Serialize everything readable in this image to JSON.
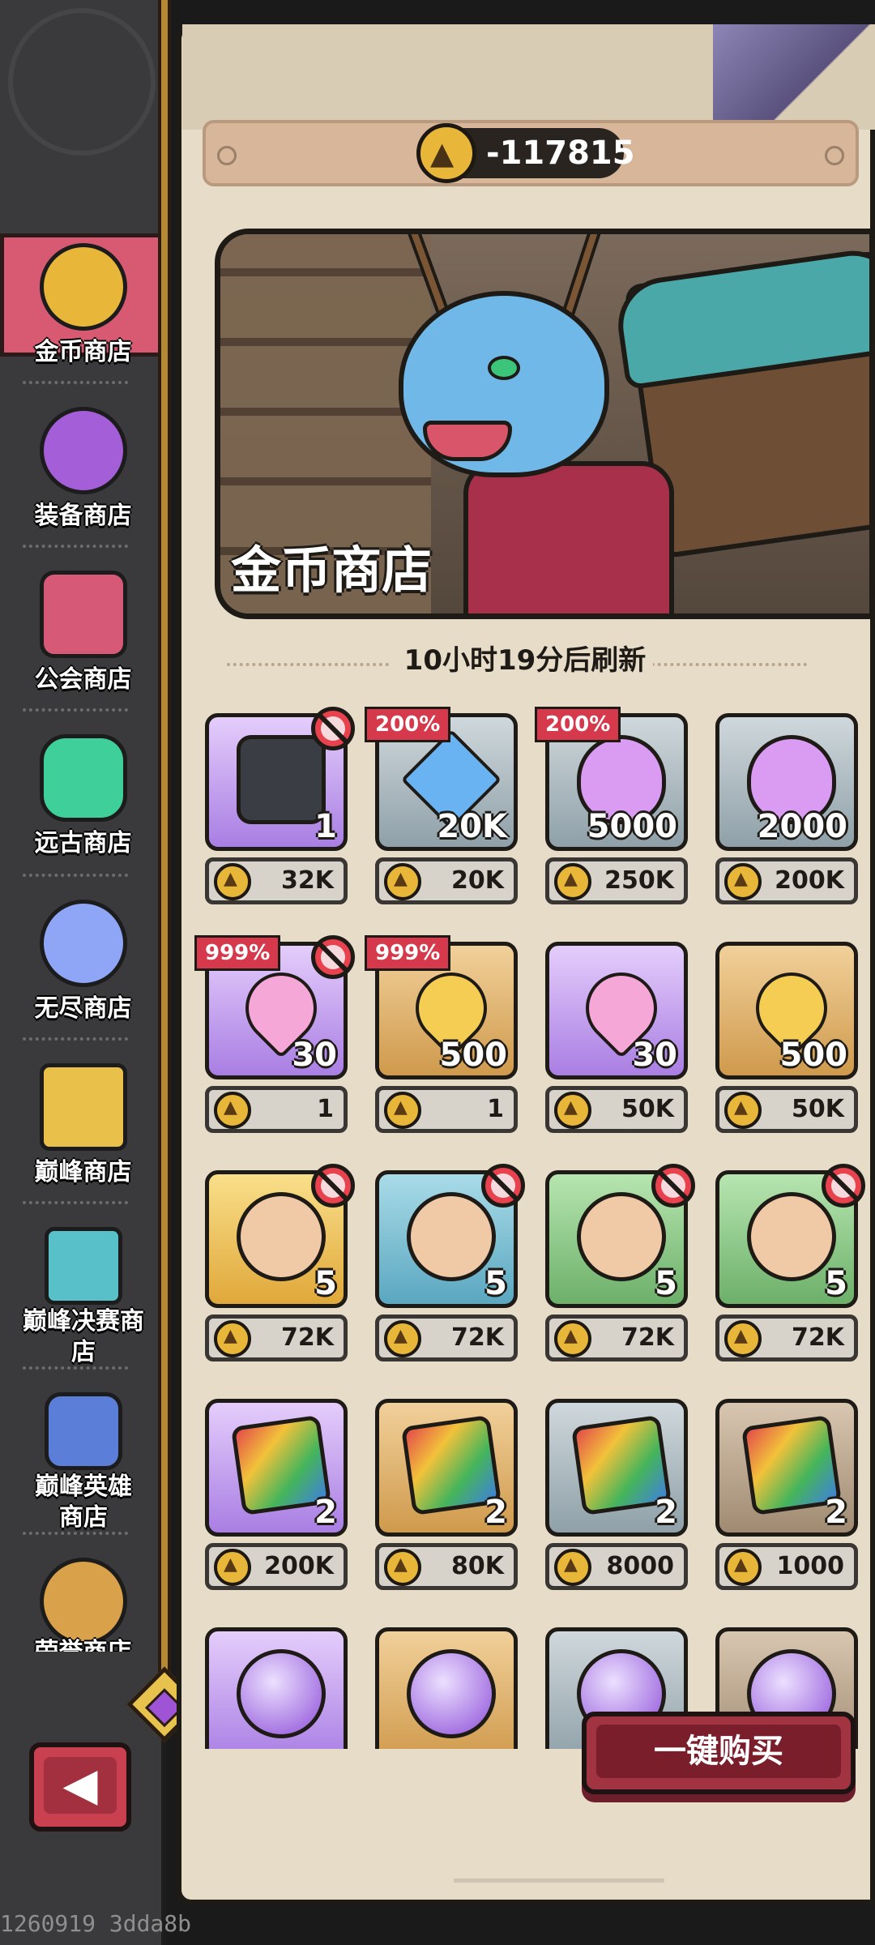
{
  "currency": {
    "icon": "coin-icon",
    "value": "-117815"
  },
  "banner": {
    "title": "金币商店"
  },
  "refresh": {
    "text": "10小时19分后刷新"
  },
  "sidebar": {
    "items": [
      {
        "label": "金币商店",
        "icon": "coin-icon",
        "active": true
      },
      {
        "label": "装备商店",
        "icon": "purple-gem-icon"
      },
      {
        "label": "公会商店",
        "icon": "guild-star-icon"
      },
      {
        "label": "远古商店",
        "icon": "green-crystal-icon"
      },
      {
        "label": "无尽商店",
        "icon": "blue-slime-icon"
      },
      {
        "label": "巅峰商店",
        "icon": "crown-icon"
      },
      {
        "label": "巅峰决赛商店",
        "icon": "teal-crown-icon"
      },
      {
        "label": "巅峰英雄商店",
        "icon": "hero-portrait-icon"
      },
      {
        "label": "荣誉商店",
        "icon": "crossed-swords-icon"
      }
    ]
  },
  "grid": {
    "items": [
      {
        "art": "helmet-book-icon",
        "bg": "purple",
        "qty": "1",
        "price": "32K",
        "promo": "",
        "locked": true
      },
      {
        "art": "blue-crystal-icon",
        "bg": "gray",
        "qty": "20K",
        "price": "20K",
        "promo": "200%",
        "locked": false
      },
      {
        "art": "purple-potion-icon",
        "bg": "gray",
        "qty": "5000",
        "price": "250K",
        "promo": "200%",
        "locked": false
      },
      {
        "art": "purple-potion-icon",
        "bg": "gray",
        "qty": "2000",
        "price": "200K",
        "promo": "",
        "locked": false
      },
      {
        "art": "pink-heart-icon",
        "bg": "purple",
        "qty": "30",
        "price": "1",
        "promo": "999%",
        "locked": true
      },
      {
        "art": "gold-heart-icon",
        "bg": "orange",
        "qty": "500",
        "price": "1",
        "promo": "999%",
        "locked": false
      },
      {
        "art": "pink-heart-icon",
        "bg": "purple",
        "qty": "30",
        "price": "50K",
        "promo": "",
        "locked": false
      },
      {
        "art": "gold-heart-icon",
        "bg": "orange",
        "qty": "500",
        "price": "50K",
        "promo": "",
        "locked": false
      },
      {
        "art": "hero-shard-girl-icon",
        "bg": "gold",
        "qty": "5",
        "price": "72K",
        "promo": "",
        "locked": true
      },
      {
        "art": "hero-shard-mask-icon",
        "bg": "teal",
        "qty": "5",
        "price": "72K",
        "promo": "",
        "locked": true
      },
      {
        "art": "hero-shard-elf-icon",
        "bg": "green",
        "qty": "5",
        "price": "72K",
        "promo": "",
        "locked": true
      },
      {
        "art": "hero-shard-sage-icon",
        "bg": "green",
        "qty": "5",
        "price": "72K",
        "promo": "",
        "locked": true
      },
      {
        "art": "summon-book-icon",
        "bg": "purple",
        "qty": "2",
        "price": "200K",
        "promo": "",
        "locked": false
      },
      {
        "art": "summon-book-icon",
        "bg": "orange",
        "qty": "2",
        "price": "80K",
        "promo": "",
        "locked": false
      },
      {
        "art": "summon-book-icon",
        "bg": "gray",
        "qty": "2",
        "price": "8000",
        "promo": "",
        "locked": false
      },
      {
        "art": "summon-book-icon",
        "bg": "brown",
        "qty": "2",
        "price": "1000",
        "promo": "",
        "locked": false
      },
      {
        "art": "purple-orb-icon",
        "bg": "purple",
        "qty": "",
        "price": "",
        "promo": "",
        "locked": false
      },
      {
        "art": "purple-orb-icon",
        "bg": "orange",
        "qty": "",
        "price": "",
        "promo": "",
        "locked": false
      },
      {
        "art": "purple-orb-icon",
        "bg": "gray",
        "qty": "",
        "price": "",
        "promo": "",
        "locked": false
      },
      {
        "art": "purple-orb-icon",
        "bg": "brown",
        "qty": "",
        "price": "",
        "promo": "",
        "locked": false
      }
    ]
  },
  "buttons": {
    "buy_all": "一键购买",
    "back_icon": "back-arrow-icon"
  },
  "debug": {
    "label": "1260919 3dda8b"
  },
  "colors": {
    "accent": "#d85a72",
    "panel": "#e7dcc8",
    "sidebar": "#3a3a3c",
    "coin": "#e8b739"
  }
}
